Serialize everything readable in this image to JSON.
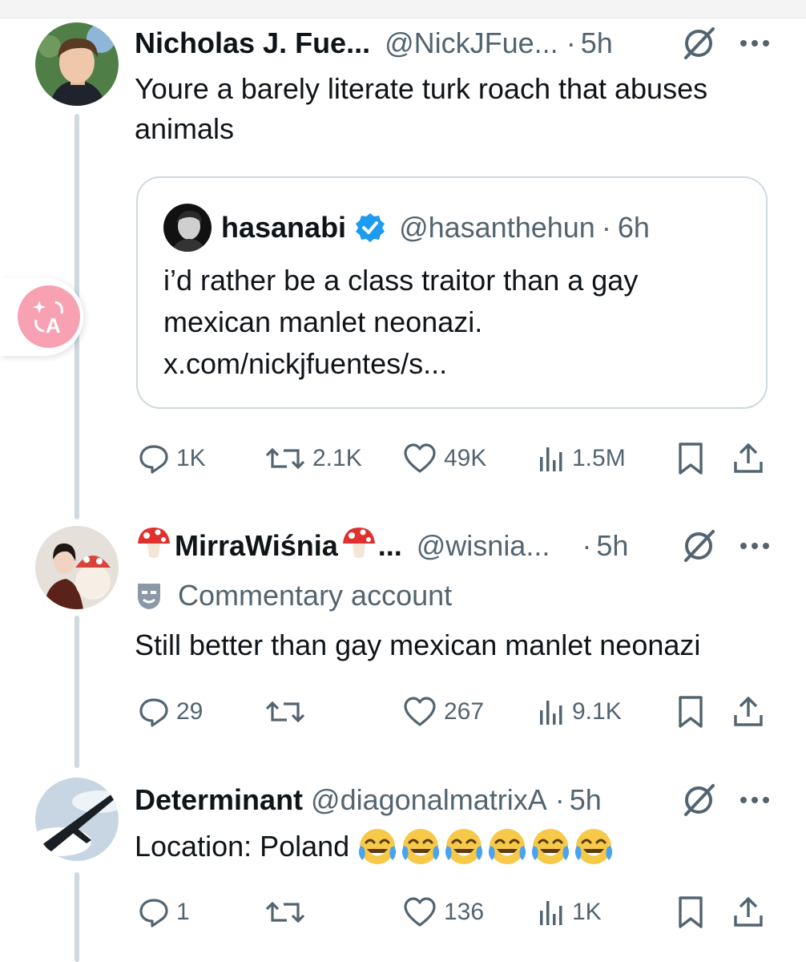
{
  "colors": {
    "text": "#0f1419",
    "muted": "#536471",
    "line": "#cfd9de",
    "verified": "#1d9bf0",
    "translate": "#f7a1b3"
  },
  "tweets": [
    {
      "name": "Nicholas J. Fue...",
      "handle": "@NickJFue...",
      "sep": "·",
      "time": "5h",
      "text_lines": [
        "Youre a barely literate turk roach that abuses",
        "animals"
      ],
      "quote": {
        "name": "hasanabi",
        "handle": "@hasanthehun",
        "sep": "·",
        "time": "6h",
        "text_lines": [
          "i’d rather be a class traitor than a gay",
          "mexican manlet neonazi.",
          "x.com/nickjfuentes/s..."
        ]
      },
      "stats": {
        "replies": "1K",
        "reposts": "2.1K",
        "likes": "49K",
        "views": "1.5M"
      }
    },
    {
      "name": "MirraWiśnia",
      "name_suffix": "...",
      "handle": "@wisnia...",
      "sep": "·",
      "time": "5h",
      "label": "Commentary account",
      "text": "Still better than gay mexican manlet neonazi",
      "stats": {
        "replies": "29",
        "reposts": "",
        "likes": "267",
        "views": "9.1K"
      }
    },
    {
      "name": "Determinant",
      "handle": "@diagonalmatrixA",
      "sep": "·",
      "time": "5h",
      "text": "Location: Poland",
      "emoji": "face-with-tears-of-joy",
      "emoji_count": 6,
      "stats": {
        "replies": "1",
        "reposts": "",
        "likes": "136",
        "views": "1K"
      }
    }
  ],
  "icons": [
    "grok-icon",
    "more-icon",
    "reply-icon",
    "repost-icon",
    "like-icon",
    "views-icon",
    "bookmark-icon",
    "share-icon",
    "verified-icon",
    "mask-icon",
    "translate-icon",
    "mushroom-icon"
  ]
}
